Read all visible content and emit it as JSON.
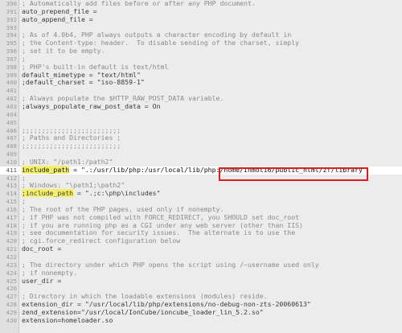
{
  "editor": {
    "highlight_color": "#f4f06a",
    "annotation_color": "#e01b1b",
    "lines": [
      {
        "n": "390",
        "text": "; Automatically add files before or after any PHP document.",
        "type": "comment"
      },
      {
        "n": "391",
        "text": "auto_prepend_file =",
        "type": "code"
      },
      {
        "n": "392",
        "text": "auto_append_file =",
        "type": "code"
      },
      {
        "n": "393",
        "text": "",
        "type": "code"
      },
      {
        "n": "394",
        "text": "; As of 4.0b4, PHP always outputs a character encoding by default in",
        "type": "comment"
      },
      {
        "n": "395",
        "text": "; the Content-type: header.  To disable sending of the charset, simply",
        "type": "comment"
      },
      {
        "n": "396",
        "text": "; set it to be empty.",
        "type": "comment"
      },
      {
        "n": "397",
        "text": ";",
        "type": "comment"
      },
      {
        "n": "398",
        "text": "; PHP's built-in default is text/html",
        "type": "comment"
      },
      {
        "n": "399",
        "text": "default_mimetype = \"text/html\"",
        "type": "code"
      },
      {
        "n": "400",
        "text": ";default_charset = \"iso-8859-1\"",
        "type": "code"
      },
      {
        "n": "401",
        "text": "",
        "type": "code"
      },
      {
        "n": "402",
        "text": "; Always populate the $HTTP_RAW_POST_DATA variable.",
        "type": "comment"
      },
      {
        "n": "403",
        "text": ";always_populate_raw_post_data = On",
        "type": "code"
      },
      {
        "n": "404",
        "text": "",
        "type": "code"
      },
      {
        "n": "405",
        "text": "",
        "type": "code"
      },
      {
        "n": "406",
        "text": ";;;;;;;;;;;;;;;;;;;;;;;;;",
        "type": "comment"
      },
      {
        "n": "407",
        "text": "; Paths and Directories ;",
        "type": "comment"
      },
      {
        "n": "408",
        "text": ";;;;;;;;;;;;;;;;;;;;;;;;;",
        "type": "comment"
      },
      {
        "n": "409",
        "text": "",
        "type": "code"
      },
      {
        "n": "410",
        "text": "; UNIX: \"/path1:/path2\"",
        "type": "comment"
      },
      {
        "n": "411",
        "text": "include_path = \".:/usr/lib/php:/usr/local/lib/php:/home/inmoti6/public_html/zf/library\"",
        "type": "current",
        "key": "include_path",
        "rest": " = \".:/usr/lib/php:/usr/local/lib/php:/home/inmoti6/public_html/zf/library\""
      },
      {
        "n": "412",
        "text": ";",
        "type": "comment"
      },
      {
        "n": "413",
        "text": "; Windows: \"\\path1;\\path2\"",
        "type": "comment"
      },
      {
        "n": "414",
        "text": ";include_path = \".;c:\\php\\includes\"",
        "type": "hlcode",
        "key": ";include_path",
        "rest": " = \".;c:\\php\\includes\""
      },
      {
        "n": "415",
        "text": ";",
        "type": "comment"
      },
      {
        "n": "416",
        "text": "; The root of the PHP pages, used only if nonempty.",
        "type": "comment"
      },
      {
        "n": "417",
        "text": "; if PHP was not compiled with FORCE_REDIRECT, you SHOULD set doc_root",
        "type": "comment"
      },
      {
        "n": "418",
        "text": "; if you are running php as a CGI under any web server (other than IIS)",
        "type": "comment"
      },
      {
        "n": "419",
        "text": "; see documentation for security issues.  The alternate is to use the",
        "type": "comment"
      },
      {
        "n": "420",
        "text": "; cgi.force_redirect configuration below",
        "type": "comment"
      },
      {
        "n": "421",
        "text": "doc_root =",
        "type": "code"
      },
      {
        "n": "422",
        "text": "",
        "type": "code"
      },
      {
        "n": "423",
        "text": "; The directory under which PHP opens the script using /~username used only",
        "type": "comment"
      },
      {
        "n": "424",
        "text": "; if nonempty.",
        "type": "comment"
      },
      {
        "n": "425",
        "text": "user_dir =",
        "type": "code"
      },
      {
        "n": "426",
        "text": "",
        "type": "code"
      },
      {
        "n": "427",
        "text": "; Directory in which the loadable extensions (modules) reside.",
        "type": "comment"
      },
      {
        "n": "428",
        "text": "extension_dir = \"/usr/local/lib/php/extensions/no-debug-non-zts-20060613\"",
        "type": "code"
      },
      {
        "n": "429",
        "text": "zend_extension=\"/usr/local/IonCube/ioncube_loader_lin_5.2.so\"",
        "type": "code"
      },
      {
        "n": "430",
        "text": "extension=homeloader.so",
        "type": "code"
      }
    ]
  }
}
